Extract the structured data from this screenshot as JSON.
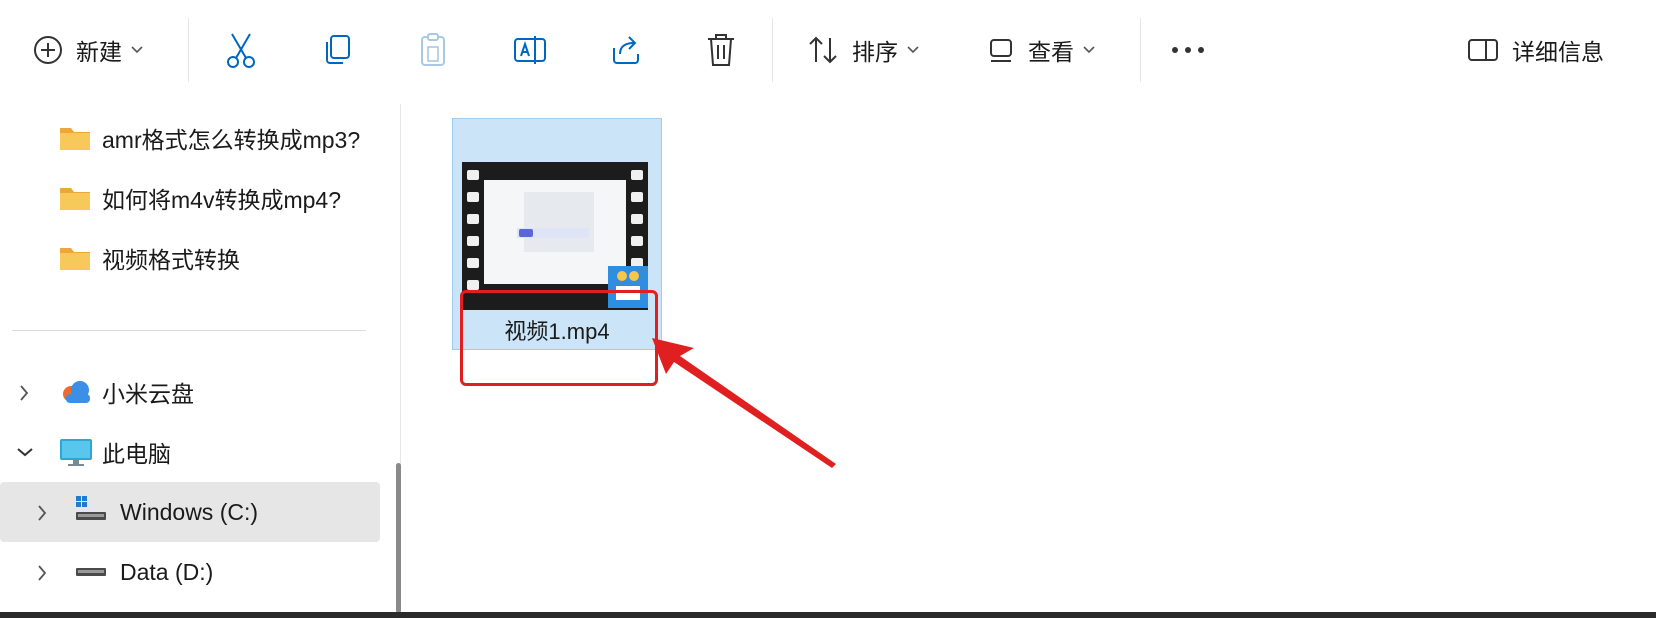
{
  "toolbar": {
    "new_label": "新建",
    "sort_label": "排序",
    "view_label": "查看",
    "more_label": "···",
    "details_label": "详细信息"
  },
  "sidebar": {
    "folders": [
      {
        "label": "amr格式怎么转换成mp3?"
      },
      {
        "label": "如何将m4v转换成mp4?"
      },
      {
        "label": "视频格式转换"
      }
    ],
    "locations": [
      {
        "label": "小米云盘",
        "expanded": false
      },
      {
        "label": "此电脑",
        "expanded": true
      }
    ],
    "drives": [
      {
        "label": "Windows (C:)",
        "selected": true
      },
      {
        "label": "Data (D:)",
        "selected": false
      }
    ]
  },
  "content": {
    "files": [
      {
        "name": "视频1.mp4",
        "selected": true
      }
    ]
  },
  "colors": {
    "accent": "#0067c0",
    "selection": "#cce4f7",
    "annotation": "#e02020",
    "folder": "#f2c14e"
  }
}
